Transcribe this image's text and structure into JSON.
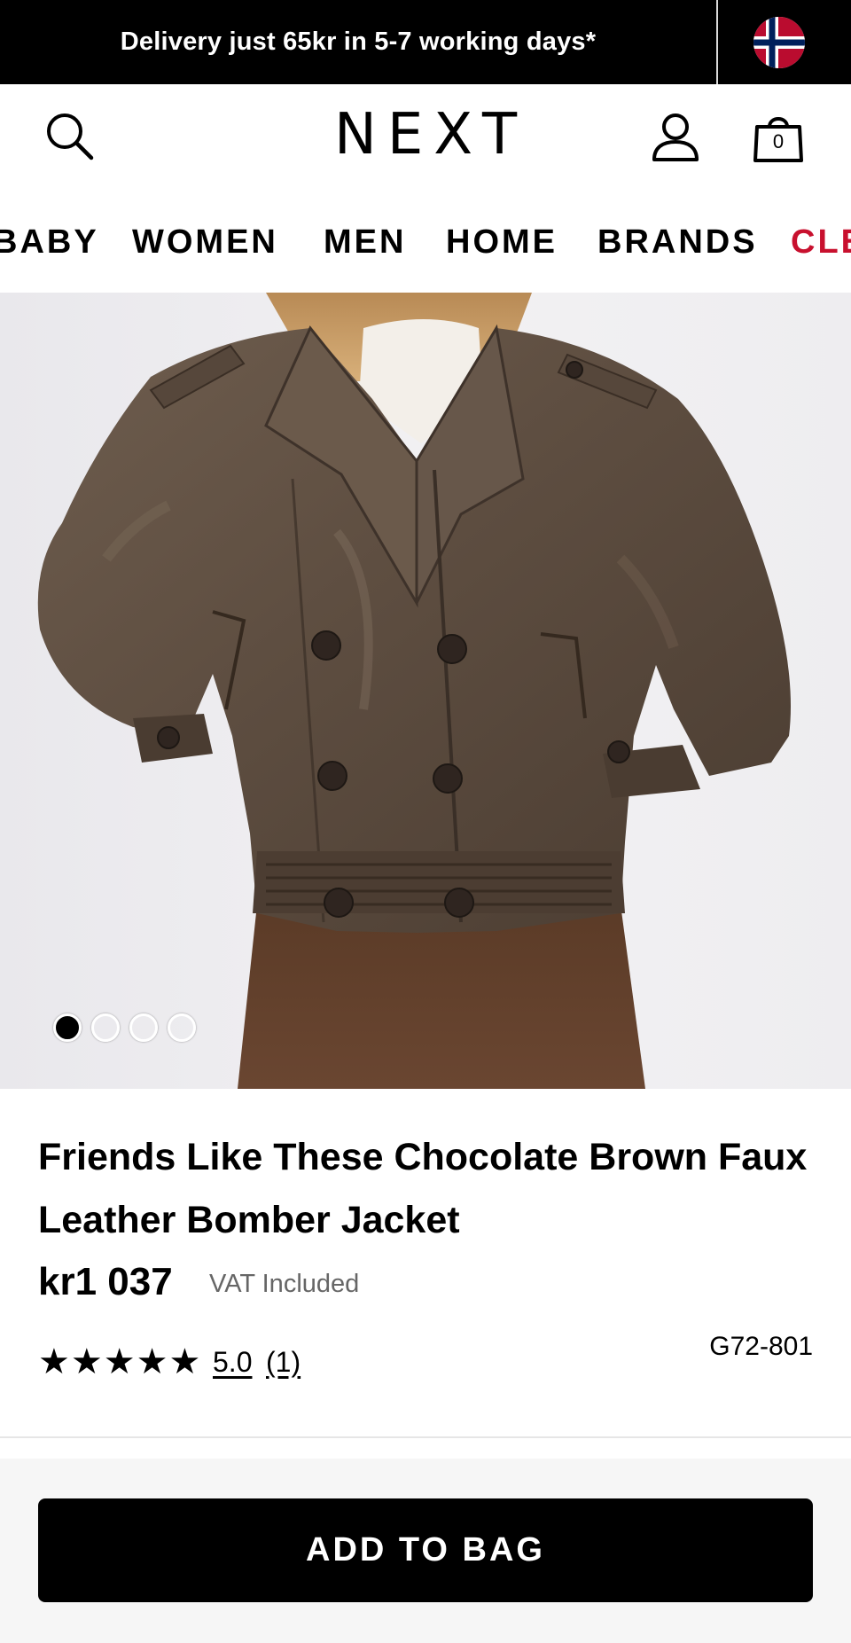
{
  "banner": {
    "text": "Delivery just 65kr in 5-7 working days*",
    "flag_icon": "norway-flag-icon"
  },
  "header": {
    "logo": "NEXT",
    "search_icon": "search-icon",
    "account_icon": "account-icon",
    "bag_icon": "shopping-bag-icon",
    "bag_count": "0"
  },
  "nav": {
    "items": [
      {
        "label": "BABY"
      },
      {
        "label": "WOMEN"
      },
      {
        "label": "MEN"
      },
      {
        "label": "HOME"
      },
      {
        "label": "BRANDS"
      },
      {
        "label": "CLE"
      }
    ],
    "sale_color": "#c8102e"
  },
  "gallery": {
    "image_count": 4,
    "active_index": 0
  },
  "product": {
    "title": "Friends Like These Chocolate Brown Faux Leather Bomber Jacket",
    "price": "kr1 037",
    "vat_note": "VAT Included",
    "rating": "5.0",
    "rating_count": "(1)",
    "stars": 5,
    "item_code": "G72-801"
  },
  "cta": {
    "add_to_bag": "ADD TO BAG"
  }
}
